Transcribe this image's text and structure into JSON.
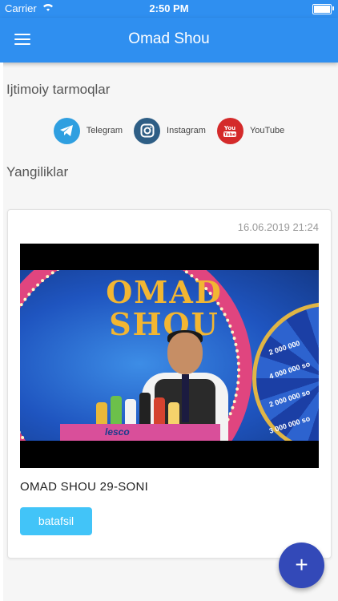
{
  "status_bar": {
    "carrier": "Carrier",
    "time": "2:50 PM"
  },
  "app_bar": {
    "title": "Omad Shou",
    "menu_icon": "hamburger-menu-icon"
  },
  "social_section": {
    "title": "Ijtimoiy tarmoqlar",
    "links": [
      {
        "label": "Telegram",
        "icon": "telegram-icon",
        "color": "#2f9fe0"
      },
      {
        "label": "Instagram",
        "icon": "instagram-icon",
        "color": "#2e5e85"
      },
      {
        "label": "YouTube",
        "icon": "youtube-icon",
        "color": "#d42a2a"
      }
    ]
  },
  "news_section": {
    "title": "Yangiliklar",
    "posts": [
      {
        "date": "16.06.2019 21:24",
        "title": "OMAD SHOU 29-SONI",
        "button_label": "batafsil",
        "thumbnail": {
          "stage_text": "OMAD SHOU",
          "wheel_labels": [
            "2 000 000",
            "4 000 000 so",
            "2 000 000 so",
            "3 000 000 so"
          ],
          "brand": "lesco"
        }
      }
    ]
  },
  "fab": {
    "icon": "plus-icon",
    "label": "+"
  },
  "colors": {
    "primary": "#2f8ff0",
    "accent": "#3349b8",
    "button": "#42c4f8"
  }
}
